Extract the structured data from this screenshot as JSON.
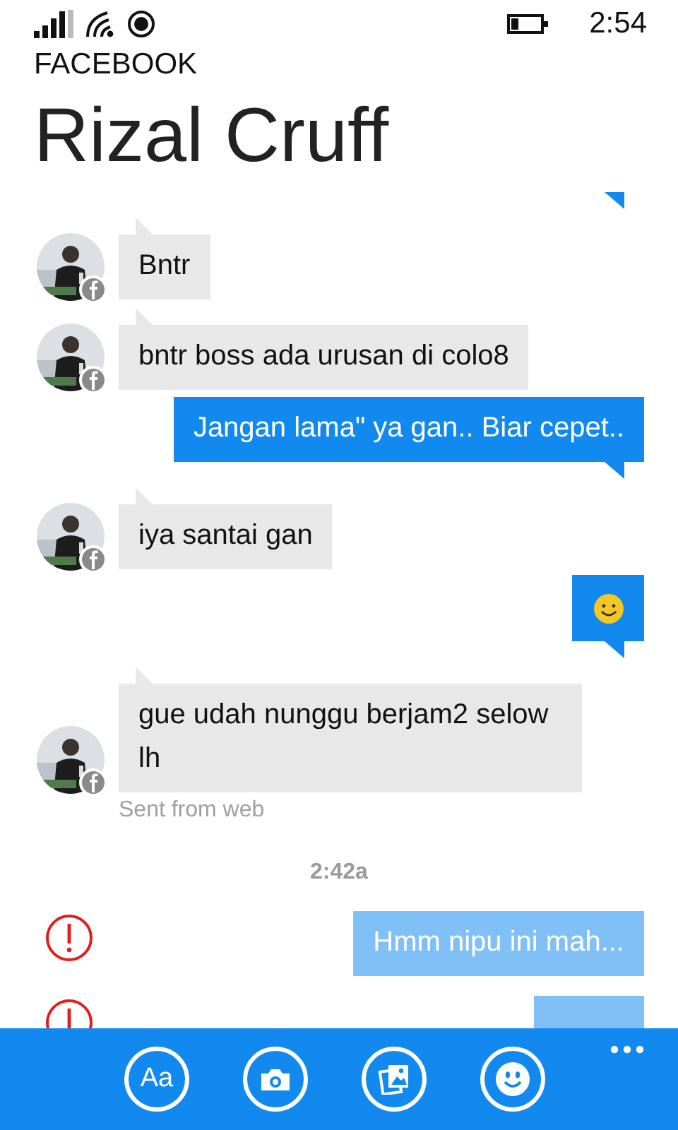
{
  "status_bar": {
    "time": "2:54"
  },
  "app_name": "FACEBOOK",
  "contact_name": "Rizal Cruff",
  "messages": [
    {
      "kind": "sent_cut",
      "failed": false
    },
    {
      "kind": "received",
      "text": "Bntr"
    },
    {
      "kind": "received",
      "text": "bntr boss ada urusan di colo8"
    },
    {
      "kind": "sent",
      "text": "Jangan lama\" ya gan.. Biar cepet..",
      "failed": false
    },
    {
      "kind": "received",
      "text": "iya santai gan"
    },
    {
      "kind": "sent_emoji",
      "failed": false
    },
    {
      "kind": "received",
      "text": "gue udah nunggu berjam2 selow lh",
      "note": "Sent from web"
    },
    {
      "kind": "timestamp",
      "text": "2:42a"
    },
    {
      "kind": "sent",
      "text": "Hmm nipu ini mah...",
      "failed": true
    },
    {
      "kind": "sent",
      "failed": true
    }
  ],
  "app_bar": {
    "buttons": [
      {
        "kind": "text",
        "label": "Aa"
      },
      {
        "kind": "camera"
      },
      {
        "kind": "photos"
      },
      {
        "kind": "emoji"
      }
    ]
  }
}
